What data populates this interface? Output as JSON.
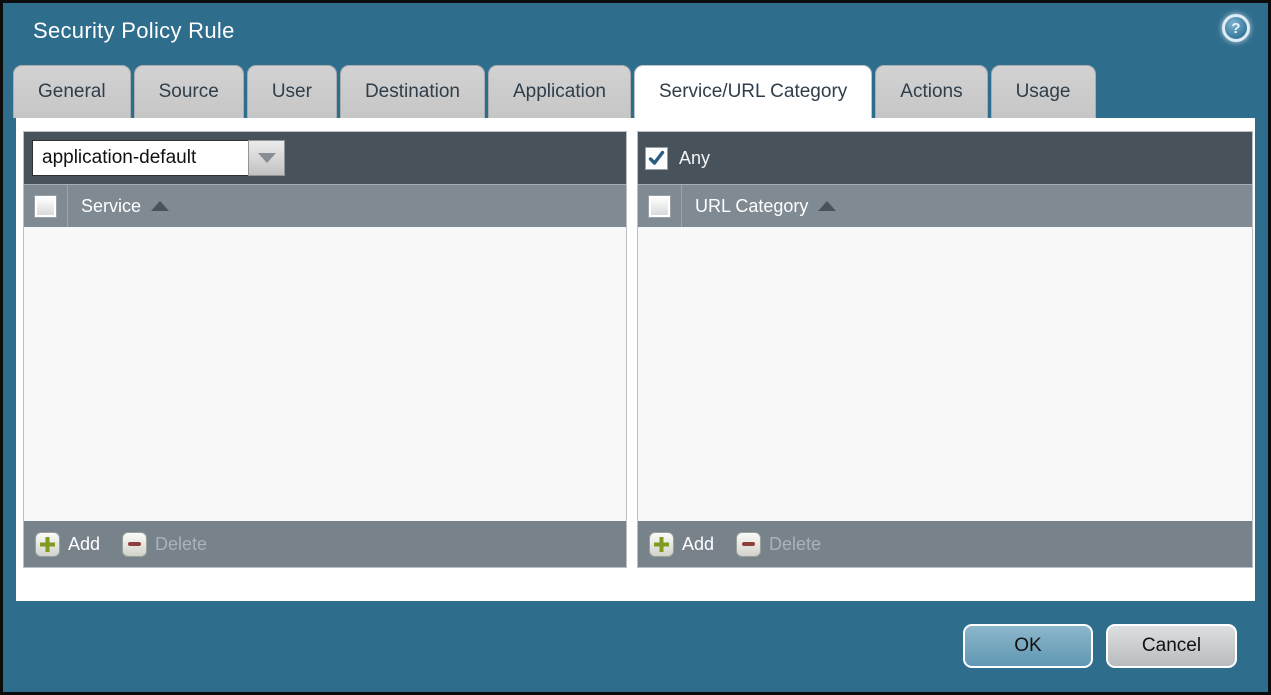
{
  "window": {
    "title": "Security Policy Rule",
    "help_icon": "question-mark"
  },
  "tabs": [
    {
      "label": "General",
      "active": false
    },
    {
      "label": "Source",
      "active": false
    },
    {
      "label": "User",
      "active": false
    },
    {
      "label": "Destination",
      "active": false
    },
    {
      "label": "Application",
      "active": false
    },
    {
      "label": "Service/URL Category",
      "active": true
    },
    {
      "label": "Actions",
      "active": false
    },
    {
      "label": "Usage",
      "active": false
    }
  ],
  "service_panel": {
    "dropdown": {
      "value": "application-default"
    },
    "header": {
      "label": "Service",
      "sort": "asc",
      "checkbox_checked": false
    },
    "rows": [],
    "footer": {
      "add_label": "Add",
      "delete_label": "Delete",
      "delete_enabled": false
    }
  },
  "url_category_panel": {
    "any": {
      "label": "Any",
      "checked": true
    },
    "header": {
      "label": "URL Category",
      "sort": "asc",
      "checkbox_checked": false
    },
    "rows": [],
    "footer": {
      "add_label": "Add",
      "delete_label": "Delete",
      "delete_enabled": false
    }
  },
  "dialog_buttons": {
    "ok_label": "OK",
    "cancel_label": "Cancel"
  },
  "colors": {
    "titlebar": "#2f6d8d",
    "toolbar_dark": "#47525b",
    "header_gray": "#7f8a93",
    "footer_gray": "#78828b",
    "tab_gray": "#cbcbcb",
    "tab_active": "#ffffff",
    "ok_button": "#6fa3bc",
    "add_green": "#7f9b1e",
    "delete_red": "#8f3d3d",
    "check_navy": "#2a5d82"
  }
}
